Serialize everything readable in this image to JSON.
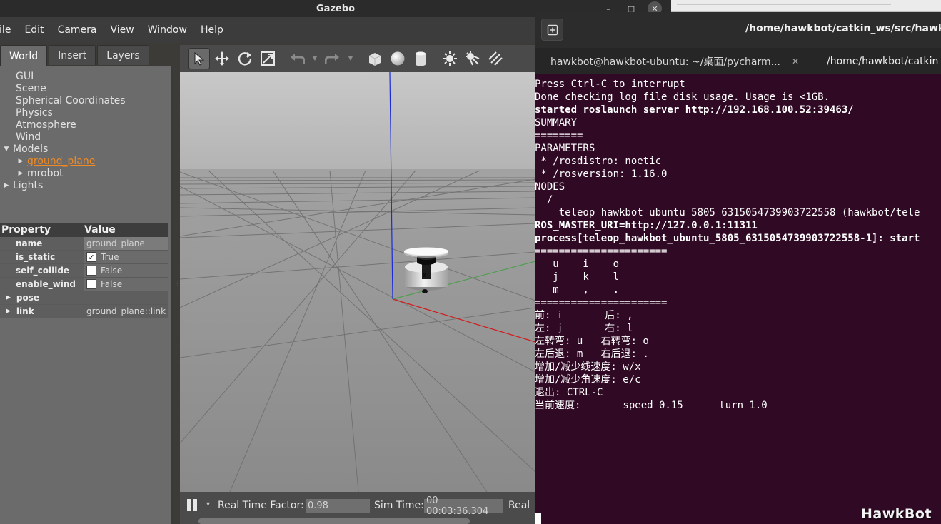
{
  "gazebo": {
    "window_title": "Gazebo",
    "window_buttons": {
      "minimize": "–",
      "maximize": "□",
      "close": "✕"
    },
    "menu": [
      "File",
      "Edit",
      "Camera",
      "View",
      "Window",
      "Help"
    ],
    "tabs": [
      "World",
      "Insert",
      "Layers"
    ],
    "tree": [
      {
        "label": "GUI",
        "arrow": ""
      },
      {
        "label": "Scene",
        "arrow": ""
      },
      {
        "label": "Spherical Coordinates",
        "arrow": ""
      },
      {
        "label": "Physics",
        "arrow": ""
      },
      {
        "label": "Atmosphere",
        "arrow": ""
      },
      {
        "label": "Wind",
        "arrow": ""
      },
      {
        "label": "Models",
        "arrow": "▼"
      },
      {
        "label": "ground_plane",
        "arrow": "▶"
      },
      {
        "label": "mrobot",
        "arrow": "▶"
      },
      {
        "label": "Lights",
        "arrow": "▶"
      }
    ],
    "splitter": "......",
    "property_header": {
      "property": "Property",
      "value": "Value"
    },
    "properties": {
      "name": {
        "key": "name",
        "value": "ground_plane"
      },
      "is_static": {
        "key": "is_static",
        "value": "True",
        "check": "✓"
      },
      "self_collide": {
        "key": "self_collide",
        "value": "False"
      },
      "enable_wind": {
        "key": "enable_wind",
        "value": "False"
      },
      "pose": {
        "key": "pose",
        "value": ""
      },
      "link": {
        "key": "link",
        "value": "ground_plane::link"
      }
    },
    "status": {
      "rtf_label": "Real Time Factor:",
      "rtf_value": "0.98",
      "sim_label": "Sim Time:",
      "sim_value": "00 00:03:36.304",
      "real_label": "Real"
    },
    "toolbar_icons": [
      "select-arrow-icon",
      "translate-icon",
      "rotate-icon",
      "scale-icon",
      "undo-icon",
      "redo-icon",
      "box-icon",
      "sphere-icon",
      "cylinder-icon",
      "point-light-icon",
      "spot-light-icon",
      "directional-light-icon"
    ]
  },
  "terminal": {
    "title": "/home/hawkbot/catkin_ws/src/hawkbot",
    "tabs": [
      {
        "label": "hawkbot@hawkbot-ubuntu: ~/桌面/pycharm...",
        "close": "✕"
      },
      {
        "label": "/home/hawkbot/catkin"
      }
    ],
    "lines": {
      "l1": "Press Ctrl-C to interrupt",
      "l2": "Done checking log file disk usage. Usage is <1GB.",
      "l3": "",
      "l4": "started roslaunch server http://192.168.100.52:39463/",
      "l5": "",
      "l6": "SUMMARY",
      "l7": "========",
      "l8": "",
      "l9": "PARAMETERS",
      "l10": " * /rosdistro: noetic",
      "l11": " * /rosversion: 1.16.0",
      "l12": "",
      "l13": "NODES",
      "l14": "  /",
      "l15": "    teleop_hawkbot_ubuntu_5805_6315054739903722558 (hawkbot/tele",
      "l16": "",
      "l17": "ROS_MASTER_URI=http://127.0.0.1:11311",
      "l18": "",
      "l19": "process[teleop_hawkbot_ubuntu_5805_6315054739903722558-1]: start",
      "l20": "",
      "l21": "======================",
      "l22": "   u    i    o",
      "l23": "   j    k    l",
      "l24": "   m    ,    .",
      "l25": "======================",
      "l26": "前: i       后: ,",
      "l27": "左: j       右: l",
      "l28": "左转弯: u   右转弯: o",
      "l29": "左后退: m   右后退: .",
      "l30": "增加/减少线速度: w/x",
      "l31": "增加/减少角速度: e/c",
      "l32": "退出: CTRL-C",
      "l33": "",
      "l34": "当前速度:       speed 0.15      turn 1.0"
    },
    "watermark": "HawkBot"
  }
}
